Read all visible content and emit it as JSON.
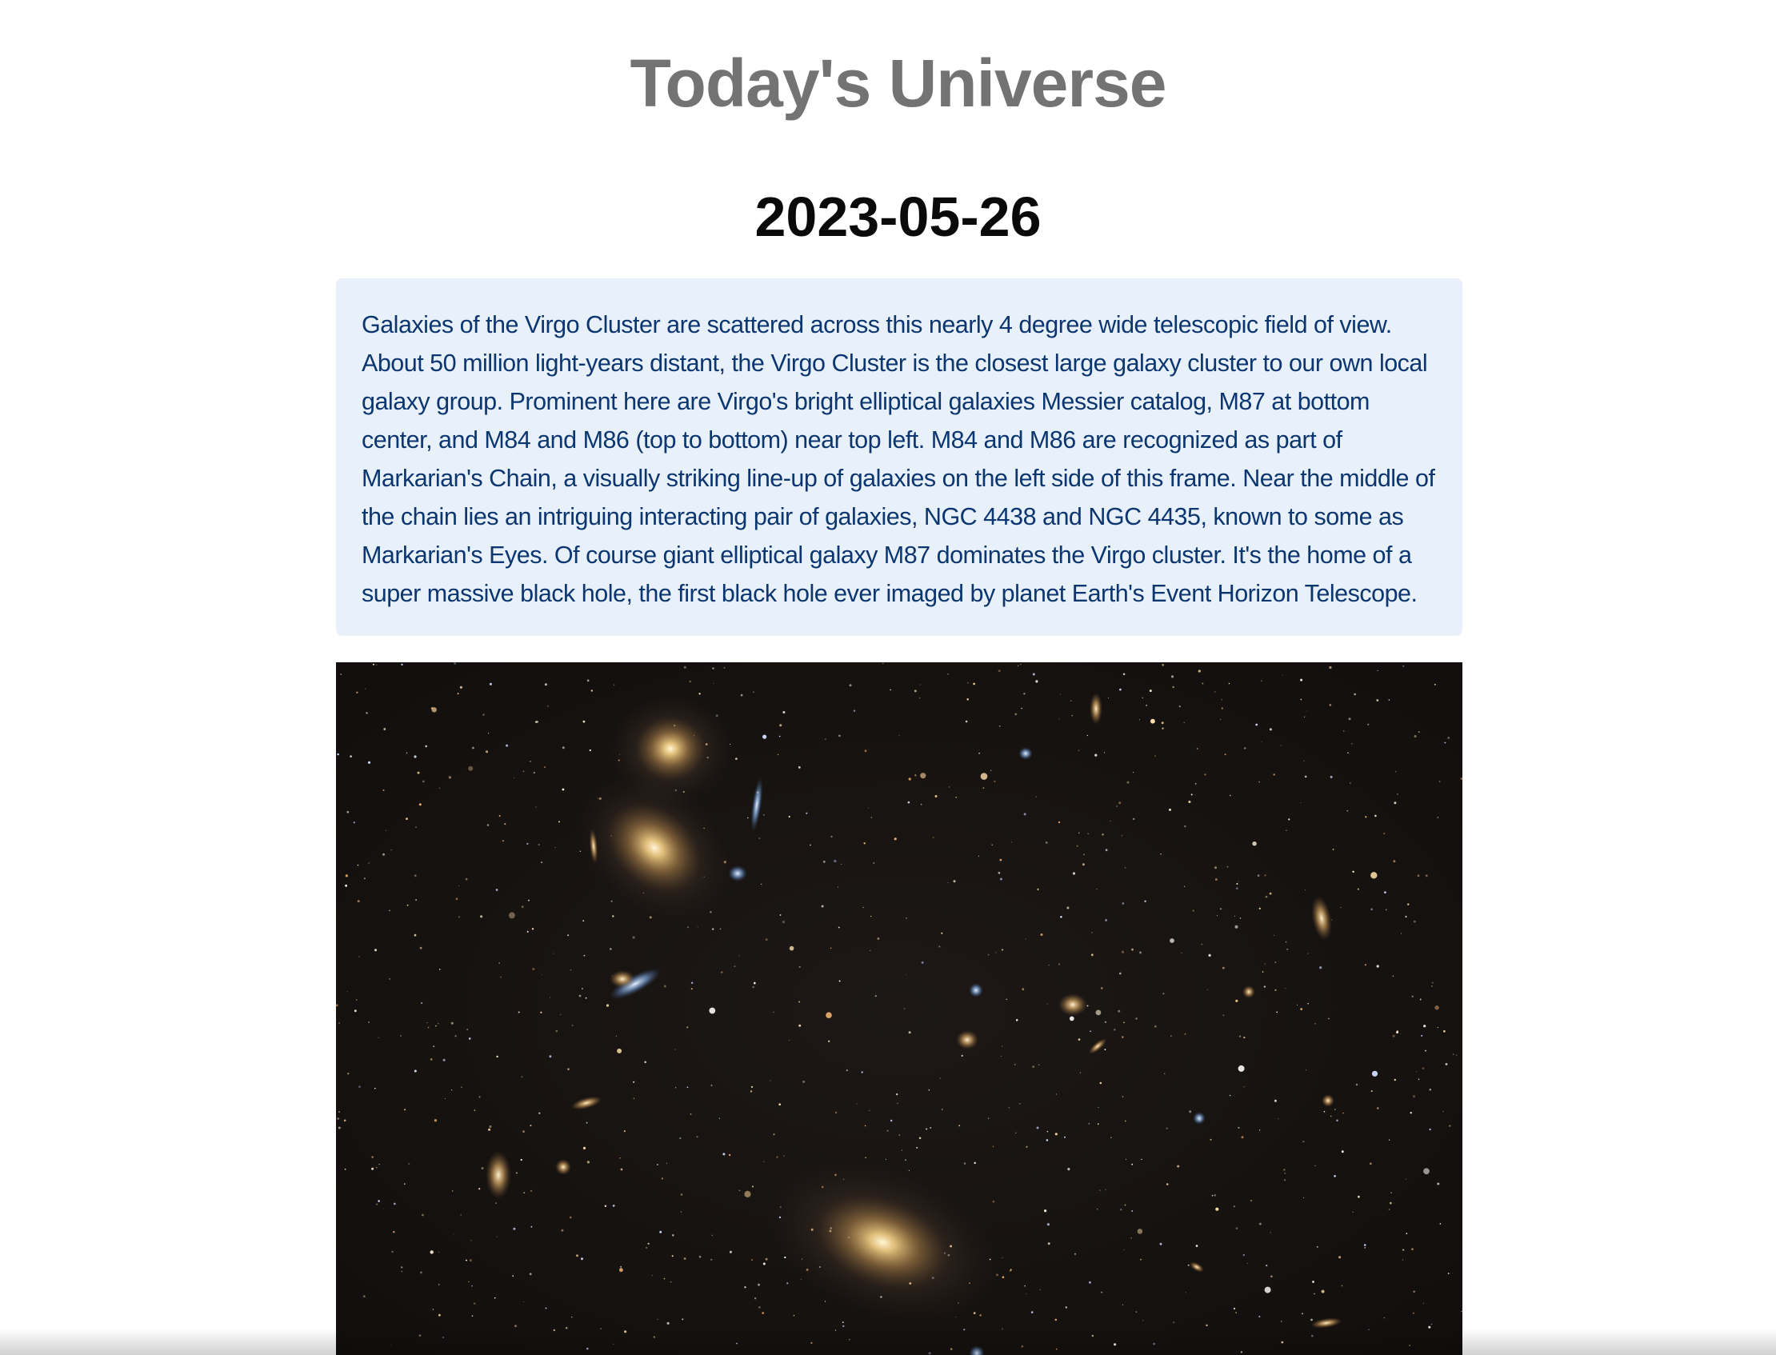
{
  "header": {
    "title": "Today's Universe",
    "date": "2023-05-26"
  },
  "explanation": {
    "text": "Galaxies of the Virgo Cluster are scattered across this nearly 4 degree wide telescopic field of view. About 50 million light-years distant, the Virgo Cluster is the closest large galaxy cluster to our own local galaxy group. Prominent here are Virgo's bright elliptical galaxies Messier catalog, M87 at bottom center, and M84 and M86 (top to bottom) near top left. M84 and M86 are recognized as part of Markarian's Chain, a visually striking line-up of galaxies on the left side of this frame. Near the middle of the chain lies an intriguing interacting pair of galaxies, NGC 4438 and NGC 4435, known to some as Markarian's Eyes. Of course giant elliptical galaxy M87 dominates the Virgo cluster. It's the home of a super massive black hole, the first black hole ever imaged by planet Earth's Event Horizon Telescope."
  },
  "colors": {
    "title": "#737373",
    "date": "#0a0a0a",
    "explanation_bg": "#e8f0fa",
    "explanation_text": "#0b3670",
    "image_bg": "#161210"
  }
}
